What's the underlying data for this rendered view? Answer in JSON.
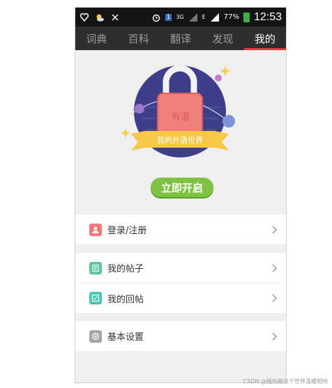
{
  "status_bar": {
    "signal_badge": "3G",
    "network_type": "E",
    "battery": "77%",
    "time": "12:53"
  },
  "tabs": [
    {
      "label": "词典",
      "active": false
    },
    {
      "label": "百科",
      "active": false
    },
    {
      "label": "翻译",
      "active": false
    },
    {
      "label": "发现",
      "active": false
    },
    {
      "label": "我的",
      "active": true
    }
  ],
  "banner": {
    "ribbon_text": "我的外语世界",
    "lock_text": "有道",
    "button_label": "立即开启"
  },
  "menu_groups": [
    [
      {
        "label": "登录/注册",
        "icon": "user-icon",
        "color": "#f2787a"
      }
    ],
    [
      {
        "label": "我的帖子",
        "icon": "post-icon",
        "color": "#5cc49a"
      },
      {
        "label": "我的回帖",
        "icon": "reply-icon",
        "color": "#4cc3b2"
      }
    ],
    [
      {
        "label": "基本设置",
        "icon": "gear-icon",
        "color": "#a6a6a6"
      }
    ]
  ],
  "colors": {
    "accent": "#e4393c",
    "button": "#7fc242",
    "ribbon": "#f7c843",
    "lock": "#f17f7e",
    "circle": "#3f3e8a"
  },
  "watermark": "CSDN @摇你被这个世界温暖相待"
}
